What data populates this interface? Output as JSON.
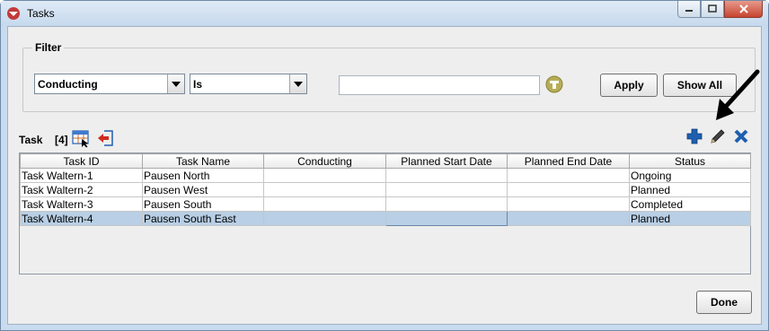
{
  "window": {
    "title": "Tasks"
  },
  "filter": {
    "legend": "Filter",
    "field_value": "Conducting",
    "operator_value": "Is",
    "text_value": "",
    "apply_label": "Apply",
    "show_all_label": "Show All"
  },
  "tasks": {
    "label": "Task",
    "count": "[4]",
    "columns": [
      "Task ID",
      "Task Name",
      "Conducting",
      "Planned Start Date",
      "Planned End Date",
      "Status"
    ],
    "rows": [
      [
        "Task Waltern-1",
        "Pausen North",
        "",
        "",
        "",
        "Ongoing"
      ],
      [
        "Task Waltern-2",
        "Pausen West",
        "",
        "",
        "",
        "Planned"
      ],
      [
        "Task Waltern-3",
        "Pausen South",
        "",
        "",
        "",
        "Completed"
      ],
      [
        "Task Waltern-4",
        "Pausen South East",
        "",
        "",
        "",
        "Planned"
      ]
    ],
    "selected_row": 3
  },
  "footer": {
    "done_label": "Done"
  },
  "icons": {
    "app": "window-app-icon",
    "filter_search": "filter-search-icon",
    "table_config": "table-config-icon",
    "export": "export-icon",
    "add": "add-icon",
    "edit": "edit-icon",
    "delete": "delete-icon"
  },
  "colors": {
    "selection": "#b8cfe5",
    "add": "#1f5fb0",
    "delete": "#1f5fb0"
  }
}
